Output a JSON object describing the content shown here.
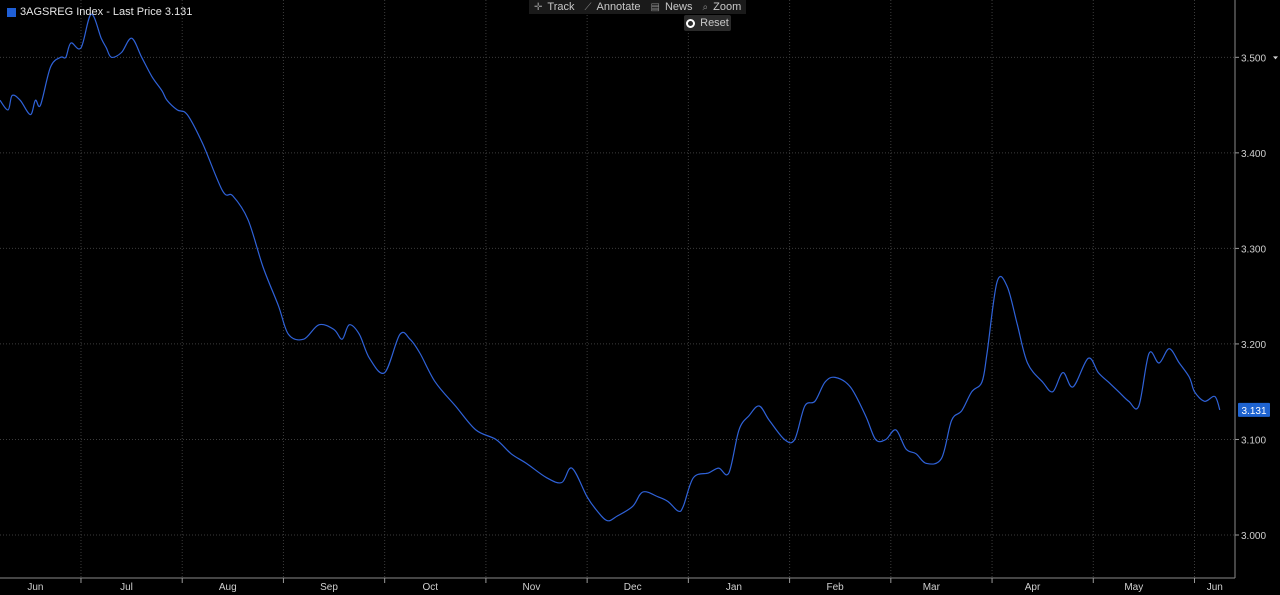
{
  "legend": {
    "label": "3AGSREG Index - Last Price 3.131",
    "swatch_color": "#1f5fd6"
  },
  "toolbar": {
    "items": [
      {
        "label": "Track",
        "icon": "crosshair-icon",
        "glyph": "✛"
      },
      {
        "label": "Annotate",
        "icon": "pencil-icon",
        "glyph": "⟋"
      },
      {
        "label": "News",
        "icon": "news-icon",
        "glyph": "▤"
      },
      {
        "label": "Zoom",
        "icon": "magnifier-icon",
        "glyph": "⌕"
      }
    ],
    "reset_label": "Reset"
  },
  "colors": {
    "line": "#2f62d8",
    "grid": "#3c3c3c",
    "axis_text": "#cfcfcf",
    "last_price_bg": "#1e63d0",
    "background": "#000000"
  },
  "chart_data": {
    "type": "line",
    "title": "",
    "xlabel": "",
    "ylabel": "",
    "series_name": "3AGSREG Index - Last Price",
    "last_value_label": "3.131",
    "last_value": 3.131,
    "ylim": [
      2.955,
      3.56
    ],
    "yticks": [
      3.0,
      3.1,
      3.2,
      3.3,
      3.4,
      3.5
    ],
    "ytick_labels": [
      "3.000",
      "3.100",
      "3.200",
      "3.300",
      "3.400",
      "3.500"
    ],
    "xlim": [
      0,
      12.2
    ],
    "month_labels": [
      "Jun",
      "Jul",
      "Aug",
      "Sep",
      "Oct",
      "Nov",
      "Dec",
      "Jan",
      "Feb",
      "Mar",
      "Apr",
      "May",
      "Jun"
    ],
    "month_label_positions": [
      0.35,
      1.25,
      2.25,
      3.25,
      4.25,
      5.25,
      6.25,
      7.25,
      8.25,
      9.2,
      10.2,
      11.2,
      12.0
    ],
    "month_boundaries": [
      0.8,
      1.8,
      2.8,
      3.8,
      4.8,
      5.8,
      6.8,
      7.8,
      8.8,
      9.8,
      10.8,
      11.8
    ],
    "grid": true,
    "x": [
      0.0,
      0.08,
      0.12,
      0.2,
      0.3,
      0.35,
      0.4,
      0.5,
      0.6,
      0.65,
      0.7,
      0.8,
      0.9,
      1.0,
      1.05,
      1.1,
      1.2,
      1.3,
      1.4,
      1.5,
      1.6,
      1.65,
      1.75,
      1.85,
      2.0,
      2.2,
      2.3,
      2.45,
      2.6,
      2.75,
      2.85,
      3.0,
      3.15,
      3.3,
      3.38,
      3.45,
      3.55,
      3.65,
      3.8,
      3.95,
      4.05,
      4.15,
      4.3,
      4.5,
      4.7,
      4.9,
      5.05,
      5.2,
      5.4,
      5.55,
      5.65,
      5.8,
      5.9,
      6.0,
      6.1,
      6.25,
      6.35,
      6.5,
      6.6,
      6.7,
      6.75,
      6.85,
      7.0,
      7.1,
      7.2,
      7.3,
      7.4,
      7.5,
      7.6,
      7.75,
      7.85,
      7.95,
      8.05,
      8.15,
      8.25,
      8.4,
      8.55,
      8.65,
      8.75,
      8.85,
      8.95,
      9.05,
      9.15,
      9.3,
      9.4,
      9.5,
      9.6,
      9.7,
      9.75,
      9.85,
      9.95,
      10.05,
      10.15,
      10.3,
      10.4,
      10.5,
      10.6,
      10.75,
      10.85,
      10.95,
      11.05,
      11.15,
      11.25,
      11.35,
      11.45,
      11.55,
      11.65,
      11.75,
      11.8,
      11.9,
      12.0,
      12.05
    ],
    "values": [
      3.455,
      3.445,
      3.46,
      3.455,
      3.44,
      3.455,
      3.45,
      3.49,
      3.5,
      3.5,
      3.515,
      3.51,
      3.545,
      3.52,
      3.51,
      3.5,
      3.505,
      3.52,
      3.5,
      3.48,
      3.465,
      3.455,
      3.445,
      3.44,
      3.41,
      3.36,
      3.355,
      3.33,
      3.28,
      3.24,
      3.21,
      3.205,
      3.22,
      3.215,
      3.205,
      3.22,
      3.21,
      3.185,
      3.17,
      3.21,
      3.205,
      3.19,
      3.16,
      3.135,
      3.11,
      3.1,
      3.085,
      3.075,
      3.06,
      3.055,
      3.07,
      3.04,
      3.025,
      3.015,
      3.02,
      3.03,
      3.045,
      3.04,
      3.035,
      3.025,
      3.03,
      3.06,
      3.065,
      3.07,
      3.065,
      3.11,
      3.125,
      3.135,
      3.12,
      3.1,
      3.1,
      3.135,
      3.14,
      3.16,
      3.165,
      3.155,
      3.125,
      3.1,
      3.1,
      3.11,
      3.09,
      3.085,
      3.075,
      3.08,
      3.12,
      3.13,
      3.15,
      3.16,
      3.19,
      3.265,
      3.26,
      3.22,
      3.18,
      3.16,
      3.15,
      3.17,
      3.155,
      3.185,
      3.17,
      3.16,
      3.15,
      3.14,
      3.135,
      3.19,
      3.18,
      3.195,
      3.18,
      3.165,
      3.15,
      3.14,
      3.145,
      3.131
    ]
  }
}
